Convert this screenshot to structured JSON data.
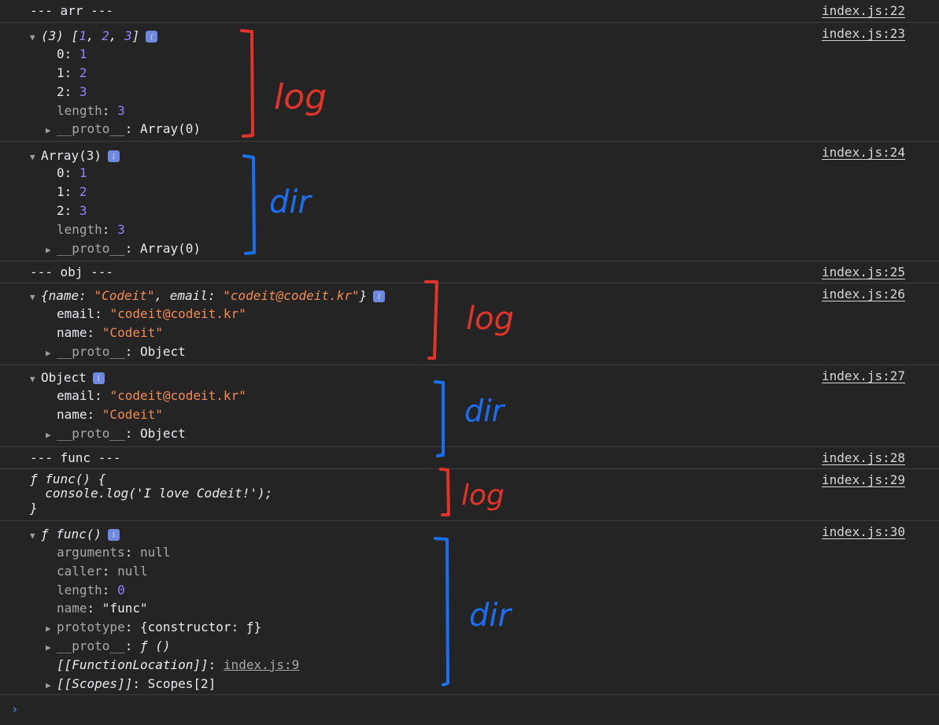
{
  "colors": {
    "background": "#242424",
    "red_annotation": "#e0342a",
    "blue_annotation": "#1a6ff0"
  },
  "entries": [
    {
      "src": "index.js:22",
      "text": "--- arr ---"
    },
    {
      "src": "index.js:23",
      "header": {
        "count": "(3)",
        "open": "[",
        "v1": "1",
        "v2": "2",
        "v3": "3",
        "close": "]"
      },
      "props": [
        {
          "k": "0",
          "v": "1"
        },
        {
          "k": "1",
          "v": "2"
        },
        {
          "k": "2",
          "v": "3"
        },
        {
          "k": "length",
          "v": "3"
        }
      ],
      "proto": {
        "k": "__proto__",
        "v": "Array(0)"
      }
    },
    {
      "src": "index.js:24",
      "header": "Array(3)",
      "props": [
        {
          "k": "0",
          "v": "1"
        },
        {
          "k": "1",
          "v": "2"
        },
        {
          "k": "2",
          "v": "3"
        },
        {
          "k": "length",
          "v": "3"
        }
      ],
      "proto": {
        "k": "__proto__",
        "v": "Array(0)"
      }
    },
    {
      "src": "index.js:25",
      "text": "--- obj ---"
    },
    {
      "src": "index.js:26",
      "header": {
        "open": "{",
        "k1": "name",
        "v1": "\"Codeit\"",
        "k2": "email",
        "v2": "\"codeit@codeit.kr\"",
        "close": "}"
      },
      "props": [
        {
          "k": "email",
          "v": "\"codeit@codeit.kr\""
        },
        {
          "k": "name",
          "v": "\"Codeit\""
        }
      ],
      "proto": {
        "k": "__proto__",
        "v": "Object"
      }
    },
    {
      "src": "index.js:27",
      "header": "Object",
      "props": [
        {
          "k": "email",
          "v": "\"codeit@codeit.kr\""
        },
        {
          "k": "name",
          "v": "\"Codeit\""
        }
      ],
      "proto": {
        "k": "__proto__",
        "v": "Object"
      }
    },
    {
      "src": "index.js:28",
      "text": "--- func ---"
    },
    {
      "src": "index.js:29",
      "lines": [
        "ƒ func() {",
        "  console.log('I love Codeit!');",
        "}"
      ]
    },
    {
      "src": "index.js:30",
      "header": "ƒ func()",
      "props": [
        {
          "k": "arguments",
          "v": "null"
        },
        {
          "k": "caller",
          "v": "null"
        },
        {
          "k": "length",
          "v": "0"
        },
        {
          "k": "name",
          "v": "\"func\""
        }
      ],
      "prototype": {
        "k": "prototype",
        "v": "{constructor: ƒ}"
      },
      "proto": {
        "k": "__proto__",
        "v": "ƒ ()"
      },
      "location": {
        "k": "[[FunctionLocation]]",
        "v": "index.js:9"
      },
      "scopes": {
        "k": "[[Scopes]]",
        "v": "Scopes[2]"
      }
    }
  ],
  "annotations": [
    "log",
    "dir",
    "log",
    "dir",
    "log",
    "dir"
  ],
  "prompt": "›"
}
